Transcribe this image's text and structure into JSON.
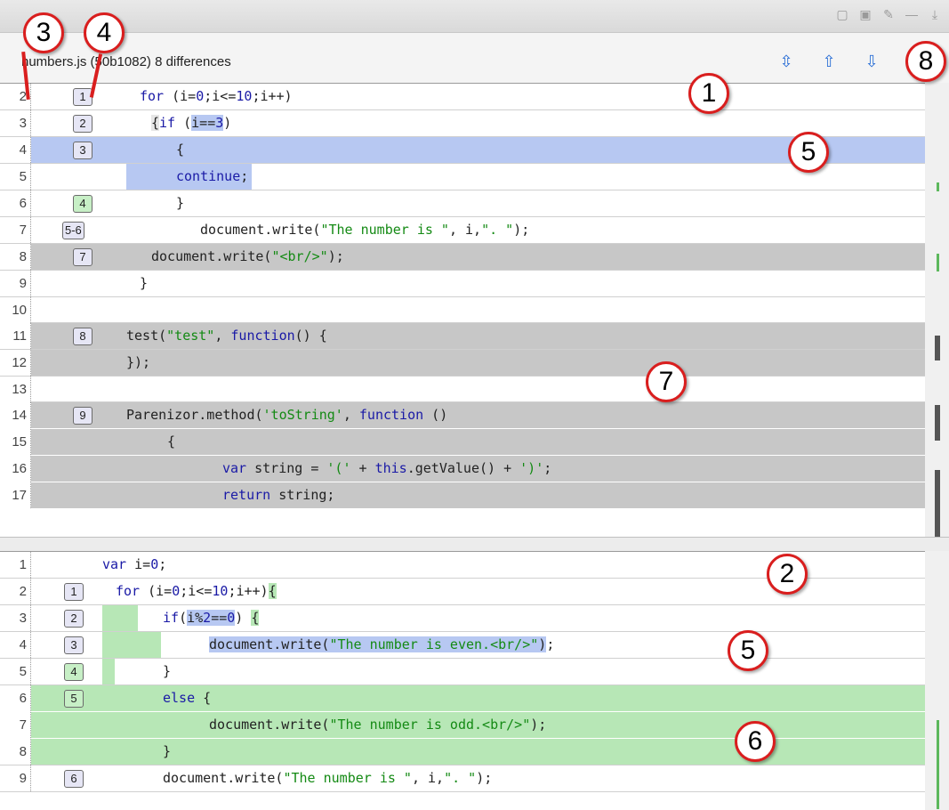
{
  "header": {
    "title": "numbers.js (50b1082) 8 differences"
  },
  "callouts": [
    "1",
    "2",
    "3",
    "4",
    "5",
    "6",
    "7",
    "8"
  ],
  "top_pane": {
    "rows": [
      {
        "line": "2",
        "diff": "1",
        "code": "for (i=0;i<=10;i++)"
      },
      {
        "line": "3",
        "diff": "2",
        "code": "{if (i==3)"
      },
      {
        "line": "4",
        "diff": "3",
        "code": "{"
      },
      {
        "line": "5",
        "diff": "",
        "code": "continue;"
      },
      {
        "line": "6",
        "diff": "4",
        "code": "}"
      },
      {
        "line": "7",
        "diff": "5-6",
        "code": "document.write(\"The number is \", i,\". \");"
      },
      {
        "line": "8",
        "diff": "7",
        "code": "document.write(\"<br/>\");"
      },
      {
        "line": "9",
        "diff": "",
        "code": "}"
      },
      {
        "line": "10",
        "diff": "",
        "code": ""
      },
      {
        "line": "11",
        "diff": "8",
        "code": "test(\"test\", function() {"
      },
      {
        "line": "12",
        "diff": "",
        "code": "});"
      },
      {
        "line": "13",
        "diff": "",
        "code": ""
      },
      {
        "line": "14",
        "diff": "9",
        "code": "Parenizor.method('toString', function ()"
      },
      {
        "line": "15",
        "diff": "",
        "code": "{"
      },
      {
        "line": "16",
        "diff": "",
        "code": "var string = '(' + this.getValue() + ')';"
      },
      {
        "line": "17",
        "diff": "",
        "code": "return string;"
      }
    ]
  },
  "bottom_pane": {
    "rows": [
      {
        "line": "1",
        "diff": "",
        "code": "var i=0;"
      },
      {
        "line": "2",
        "diff": "1",
        "code": "for (i=0;i<=10;i++){"
      },
      {
        "line": "3",
        "diff": "2",
        "code": "if(i%2==0) {"
      },
      {
        "line": "4",
        "diff": "3",
        "code": "document.write(\"The number is even.<br/>\");"
      },
      {
        "line": "5",
        "diff": "4",
        "code": "}"
      },
      {
        "line": "6",
        "diff": "5",
        "code": "else {"
      },
      {
        "line": "7",
        "diff": "",
        "code": "document.write(\"The number is odd.<br/>\");"
      },
      {
        "line": "8",
        "diff": "",
        "code": "}"
      },
      {
        "line": "9",
        "diff": "6",
        "code": "document.write(\"The number is \", i,\". \");"
      }
    ]
  },
  "icons": [
    "expand-icon",
    "up-arrow-icon",
    "down-arrow-icon",
    "settings-icon"
  ]
}
